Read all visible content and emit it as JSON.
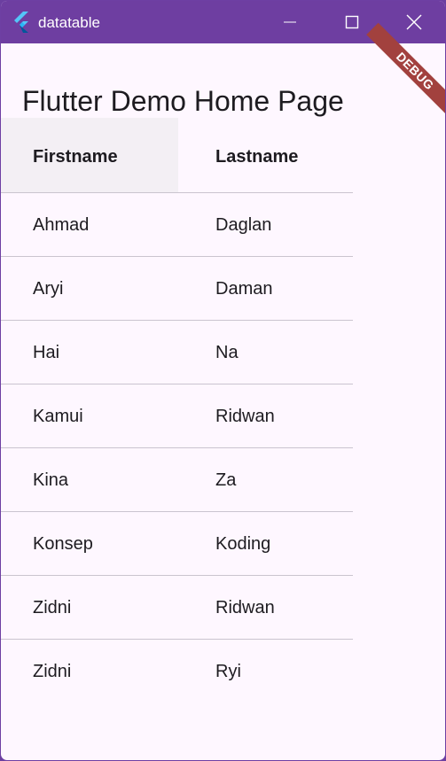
{
  "window": {
    "title": "datatable",
    "icon": "flutter-logo-icon",
    "controls": [
      "minimize-icon",
      "maximize-icon",
      "close-icon"
    ]
  },
  "banner": {
    "text": "DEBUG",
    "color": "#a2413e"
  },
  "app_bar": {
    "title": "Flutter Demo Home Page"
  },
  "table": {
    "columns": [
      "Firstname",
      "Lastname"
    ],
    "rows": [
      [
        "Ahmad",
        "Daglan"
      ],
      [
        "Aryi",
        "Daman"
      ],
      [
        "Hai",
        "Na"
      ],
      [
        "Kamui",
        "Ridwan"
      ],
      [
        "Kina",
        "Za"
      ],
      [
        "Konsep",
        "Koding"
      ],
      [
        "Zidni",
        "Ridwan"
      ],
      [
        "Zidni",
        "Ryi"
      ]
    ]
  },
  "colors": {
    "titlebar": "#6e3ea1",
    "background": "#fef7ff",
    "header_highlight": "#f3eff4",
    "divider": "#cac4cf"
  }
}
